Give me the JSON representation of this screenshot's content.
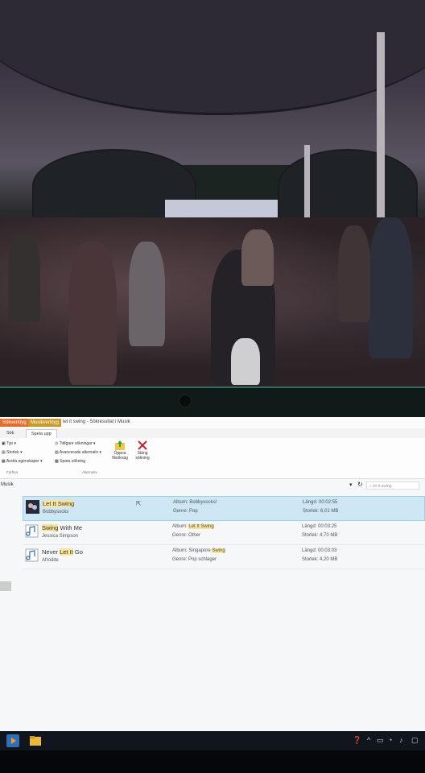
{
  "titlebar": {
    "ctx_tab1": "Sökverktyg",
    "ctx_tab2": "Musikverktyg",
    "title": "let it swing - Sökresultat i Musik"
  },
  "ribbon_tabs": [
    "Sök",
    "Spela upp"
  ],
  "ribbon": {
    "typ": "Typ",
    "storlek": "Storlek",
    "andra": "Andra egenskaper",
    "forfina": "Förfina",
    "tidigare": "Tidigare sökningar",
    "avancerade": "Avancerade alternativ",
    "spara": "Spara sökning",
    "alternativ": "Alternativ",
    "oppna_line1": "Öppna",
    "oppna_line2": "filsökväg",
    "stang_line1": "Stäng",
    "stang_line2": "sökning"
  },
  "address": {
    "location": "Musik",
    "search_placeholder": "let it swing"
  },
  "results": [
    {
      "title_parts": [
        {
          "text": "Let It Swing",
          "hl": true
        }
      ],
      "artist": "Bobbysocks",
      "album_label": "Album:",
      "album_parts": [
        {
          "text": "Bobbysocks!",
          "hl": false
        }
      ],
      "genre_label": "Genre:",
      "genre": "Pop",
      "length_label": "Längd:",
      "length": "00:02:55",
      "size_label": "Storlek:",
      "size": "6,01 MB",
      "selected": true
    },
    {
      "title_parts": [
        {
          "text": "Swing",
          "hl": true
        },
        {
          "text": " With Me",
          "hl": false
        }
      ],
      "artist": "Jessica Simpson",
      "album_label": "Album:",
      "album_parts": [
        {
          "text": "Let It Swing",
          "hl": true
        }
      ],
      "genre_label": "Genre:",
      "genre": "Other",
      "length_label": "Längd:",
      "length": "00:03:25",
      "size_label": "Storlek:",
      "size": "4,70 MB",
      "selected": false
    },
    {
      "title_parts": [
        {
          "text": "Never ",
          "hl": false
        },
        {
          "text": "Let It",
          "hl": true
        },
        {
          "text": " Go",
          "hl": false
        }
      ],
      "artist": "Afrodite",
      "album_label": "Album:",
      "album_parts": [
        {
          "text": "Singapore ",
          "hl": false
        },
        {
          "text": "Swing",
          "hl": true
        }
      ],
      "genre_label": "Genre:",
      "genre": "Pop schlager",
      "length_label": "Längd:",
      "length": "00:03:03",
      "size_label": "Storlek:",
      "size": "4,20 MB",
      "selected": false
    }
  ],
  "colors": {
    "ctx_tab1": "#e46c2c",
    "ctx_tab2": "#c89a2a",
    "selection": "#cde7f5",
    "highlight": "#f7e59a",
    "close_x": "#c0272d",
    "taskbar": "#10151e"
  },
  "icons": [
    "album-art-icon",
    "music-note-icon",
    "open-folder-icon",
    "close-search-icon",
    "refresh-icon",
    "chevron-down-icon",
    "media-player-icon",
    "file-explorer-icon",
    "help-icon",
    "network-icon",
    "volume-icon",
    "chat-icon"
  ]
}
